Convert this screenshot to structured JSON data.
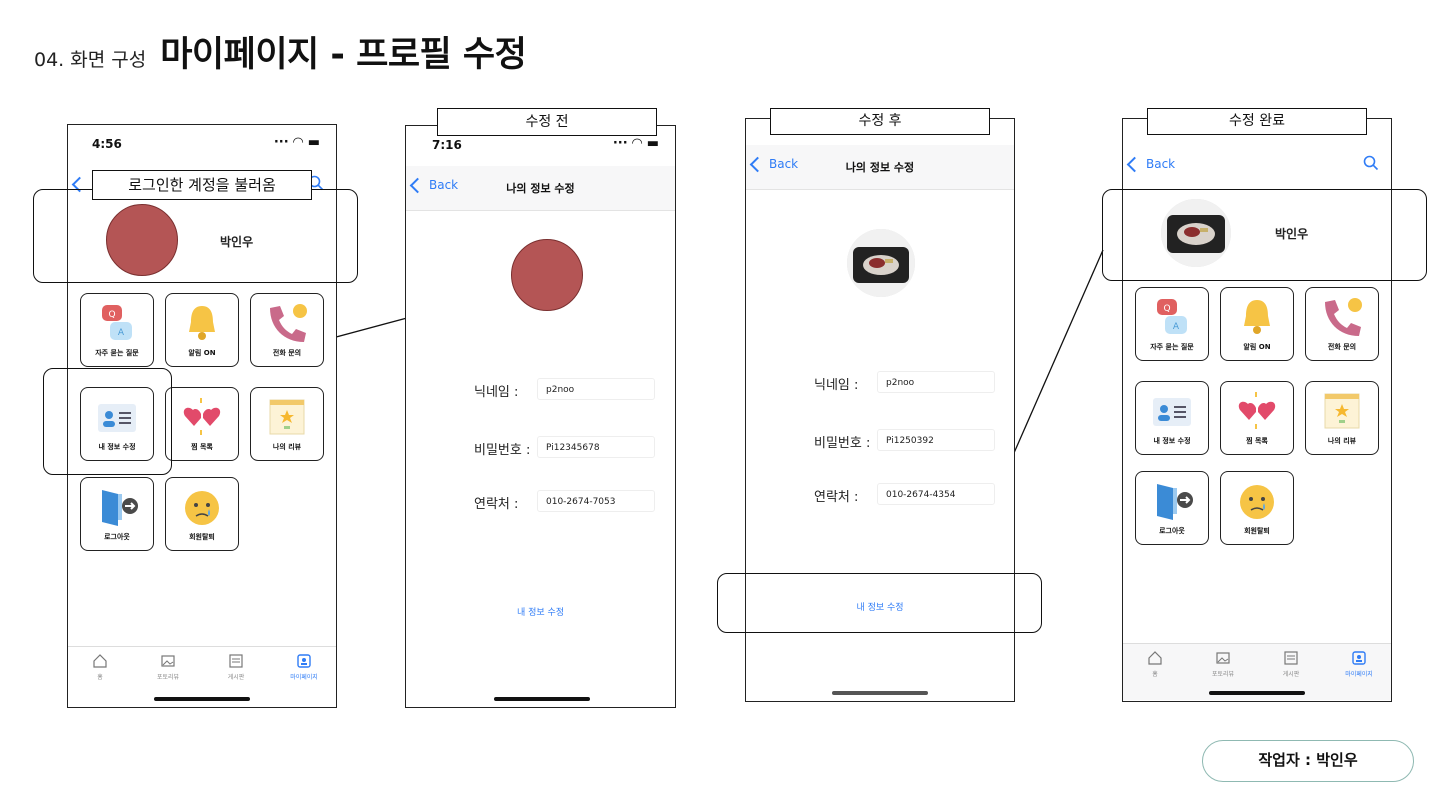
{
  "header": {
    "section": "04. 화면 구성",
    "title": "마이페이지 - 프로필 수정"
  },
  "callout_label": "로그인한 계정을 불러옴",
  "phone1": {
    "time": "4:56",
    "nav_back": "B",
    "user_name": "박인우",
    "tiles": [
      "자주 묻는 질문",
      "알림 ON",
      "전화 문의",
      "내 정보 수정",
      "찜 목록",
      "나의 리뷰",
      "로그아웃",
      "회원탈퇴"
    ],
    "tabs": [
      "홈",
      "포토리뷰",
      "게시판",
      "마이페이지"
    ]
  },
  "phone2": {
    "caption": "수정 전",
    "time": "7:16",
    "nav_back": "Back",
    "nav_title": "나의 정보 수정",
    "fields": [
      {
        "label": "닉네임 :",
        "value": "p2noo"
      },
      {
        "label": "비밀번호 :",
        "value": "Pi12345678"
      },
      {
        "label": "연락처 :",
        "value": "010-2674-7053"
      }
    ],
    "submit": "내 정보 수정"
  },
  "phone3": {
    "caption": "수정 후",
    "nav_back": "Back",
    "nav_title": "나의 정보 수정",
    "fields": [
      {
        "label": "닉네임 :",
        "value": "p2noo"
      },
      {
        "label": "비밀번호 :",
        "value": "Pi1250392"
      },
      {
        "label": "연락처 :",
        "value": "010-2674-4354"
      }
    ],
    "submit": "내 정보 수정"
  },
  "phone4": {
    "caption": "수정 완료",
    "nav_back": "Back",
    "user_name": "박인우",
    "tiles": [
      "자주 묻는 질문",
      "알림 ON",
      "전화 문의",
      "내 정보 수정",
      "찜 목록",
      "나의 리뷰",
      "로그아웃",
      "회원탈퇴"
    ],
    "tabs": [
      "홈",
      "포토리뷰",
      "게시판",
      "마이페이지"
    ]
  },
  "author": "작업자 : 박인우",
  "colors": {
    "accent": "#2f7cf6",
    "avatar": "#b45555",
    "pill_border": "#8fb9b2"
  }
}
